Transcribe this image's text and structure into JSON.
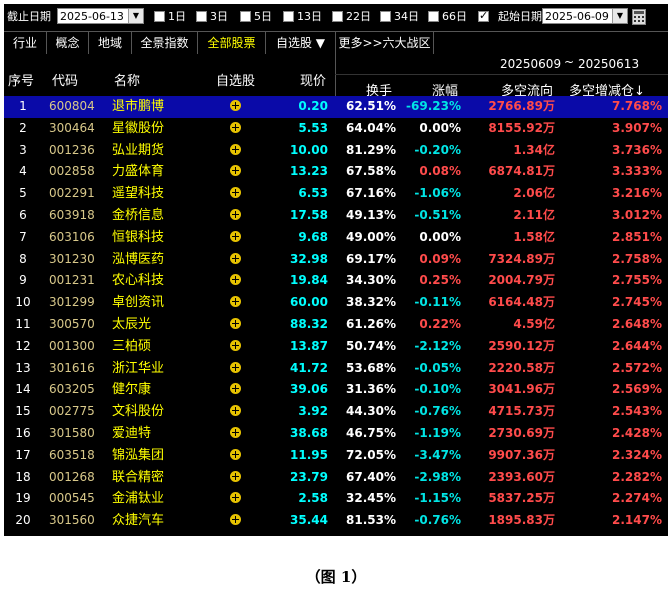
{
  "filter": {
    "end_date_label": "截止日期",
    "end_date_value": "2025-06-13",
    "periods": [
      {
        "label": "1日",
        "checked": false
      },
      {
        "label": "3日",
        "checked": false
      },
      {
        "label": "5日",
        "checked": false
      },
      {
        "label": "13日",
        "checked": false
      },
      {
        "label": "22日",
        "checked": false
      },
      {
        "label": "34日",
        "checked": false
      },
      {
        "label": "66日",
        "checked": false
      }
    ],
    "start_checked": true,
    "start_date_label": "起始日期",
    "start_date_value": "2025-06-09"
  },
  "tabs": [
    {
      "label": "行业",
      "active": false
    },
    {
      "label": "概念",
      "active": false
    },
    {
      "label": "地域",
      "active": false
    },
    {
      "label": "全景指数",
      "active": false
    },
    {
      "label": "全部股票",
      "active": true
    },
    {
      "label": "自选股 ▼",
      "active": false
    },
    {
      "label": "更多>>六大战区",
      "active": false
    }
  ],
  "header": {
    "range_start": "20250609",
    "range_sep": "~",
    "range_end": "20250613",
    "col_idx": "序号",
    "col_code": "代码",
    "col_name": "名称",
    "col_fav": "自选股",
    "col_price": "现价",
    "col_turnover": "换手",
    "col_change": "涨幅",
    "col_flow": "多空流向",
    "col_increase": "多空增减仓↓"
  },
  "rows": [
    {
      "idx": "1",
      "code": "600804",
      "name": "退市鹏博",
      "price": "0.20",
      "turnover": "62.51%",
      "change": "-69.23%",
      "dir": "down",
      "flow": "2766.89万",
      "increase": "7.768%"
    },
    {
      "idx": "2",
      "code": "300464",
      "name": "星徽股份",
      "price": "5.53",
      "turnover": "64.04%",
      "change": "0.00%",
      "dir": "flat",
      "flow": "8155.92万",
      "increase": "3.907%"
    },
    {
      "idx": "3",
      "code": "001236",
      "name": "弘业期货",
      "price": "10.00",
      "turnover": "81.29%",
      "change": "-0.20%",
      "dir": "down",
      "flow": "1.34亿",
      "increase": "3.736%"
    },
    {
      "idx": "4",
      "code": "002858",
      "name": "力盛体育",
      "price": "13.23",
      "turnover": "67.58%",
      "change": "0.08%",
      "dir": "up",
      "flow": "6874.81万",
      "increase": "3.333%"
    },
    {
      "idx": "5",
      "code": "002291",
      "name": "遥望科技",
      "price": "6.53",
      "turnover": "67.16%",
      "change": "-1.06%",
      "dir": "down",
      "flow": "2.06亿",
      "increase": "3.216%"
    },
    {
      "idx": "6",
      "code": "603918",
      "name": "金桥信息",
      "price": "17.58",
      "turnover": "49.13%",
      "change": "-0.51%",
      "dir": "down",
      "flow": "2.11亿",
      "increase": "3.012%"
    },
    {
      "idx": "7",
      "code": "603106",
      "name": "恒银科技",
      "price": "9.68",
      "turnover": "49.00%",
      "change": "0.00%",
      "dir": "flat",
      "flow": "1.58亿",
      "increase": "2.851%"
    },
    {
      "idx": "8",
      "code": "301230",
      "name": "泓博医药",
      "price": "32.98",
      "turnover": "69.17%",
      "change": "0.09%",
      "dir": "up",
      "flow": "7324.89万",
      "increase": "2.758%"
    },
    {
      "idx": "9",
      "code": "001231",
      "name": "农心科技",
      "price": "19.84",
      "turnover": "34.30%",
      "change": "0.25%",
      "dir": "up",
      "flow": "2004.79万",
      "increase": "2.755%"
    },
    {
      "idx": "10",
      "code": "301299",
      "name": "卓创资讯",
      "price": "60.00",
      "turnover": "38.32%",
      "change": "-0.11%",
      "dir": "down",
      "flow": "6164.48万",
      "increase": "2.745%"
    },
    {
      "idx": "11",
      "code": "300570",
      "name": "太辰光",
      "price": "88.32",
      "turnover": "61.26%",
      "change": "0.22%",
      "dir": "up",
      "flow": "4.59亿",
      "increase": "2.648%"
    },
    {
      "idx": "12",
      "code": "001300",
      "name": "三柏硕",
      "price": "13.87",
      "turnover": "50.74%",
      "change": "-2.12%",
      "dir": "down",
      "flow": "2590.12万",
      "increase": "2.644%"
    },
    {
      "idx": "13",
      "code": "301616",
      "name": "浙江华业",
      "price": "41.72",
      "turnover": "53.68%",
      "change": "-0.05%",
      "dir": "down",
      "flow": "2220.58万",
      "increase": "2.572%"
    },
    {
      "idx": "14",
      "code": "603205",
      "name": "健尔康",
      "price": "39.06",
      "turnover": "31.36%",
      "change": "-0.10%",
      "dir": "down",
      "flow": "3041.96万",
      "increase": "2.569%"
    },
    {
      "idx": "15",
      "code": "002775",
      "name": "文科股份",
      "price": "3.92",
      "turnover": "44.30%",
      "change": "-0.76%",
      "dir": "down",
      "flow": "4715.73万",
      "increase": "2.543%"
    },
    {
      "idx": "16",
      "code": "301580",
      "name": "爱迪特",
      "price": "38.68",
      "turnover": "46.75%",
      "change": "-1.19%",
      "dir": "down",
      "flow": "2730.69万",
      "increase": "2.428%"
    },
    {
      "idx": "17",
      "code": "603518",
      "name": "锦泓集团",
      "price": "11.95",
      "turnover": "72.05%",
      "change": "-3.47%",
      "dir": "down",
      "flow": "9907.36万",
      "increase": "2.324%"
    },
    {
      "idx": "18",
      "code": "001268",
      "name": "联合精密",
      "price": "23.79",
      "turnover": "67.40%",
      "change": "-2.98%",
      "dir": "down",
      "flow": "2393.60万",
      "increase": "2.282%"
    },
    {
      "idx": "19",
      "code": "000545",
      "name": "金浦钛业",
      "price": "2.58",
      "turnover": "32.45%",
      "change": "-1.15%",
      "dir": "down",
      "flow": "5837.25万",
      "increase": "2.274%"
    },
    {
      "idx": "20",
      "code": "301560",
      "name": "众捷汽车",
      "price": "35.44",
      "turnover": "81.53%",
      "change": "-0.76%",
      "dir": "down",
      "flow": "1895.83万",
      "increase": "2.147%"
    }
  ],
  "caption": "（图 1）"
}
